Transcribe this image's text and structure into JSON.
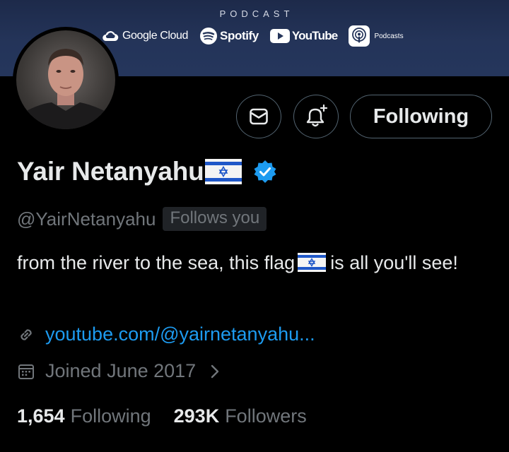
{
  "banner": {
    "title": "PODCAST",
    "sponsors": [
      {
        "name": "google-cloud",
        "label": "Google Cloud"
      },
      {
        "name": "spotify",
        "label": "Spotify"
      },
      {
        "name": "youtube",
        "label": "YouTube"
      },
      {
        "name": "apple-podcasts",
        "label": "Podcasts"
      }
    ]
  },
  "profile": {
    "name": "Yair Netanyahu",
    "handle": "@YairNetanyahu",
    "follows_badge": "Follows you",
    "bio_part1": "from the river to the sea, this flag",
    "bio_part2": "is all you'll see!",
    "link": "youtube.com/@yairnetanyahu...",
    "joined": "Joined June 2017"
  },
  "actions": {
    "following_label": "Following",
    "message_icon": "envelope-icon",
    "notify_icon": "bell-plus-icon"
  },
  "stats": {
    "following_count": "1,654",
    "following_label": "Following",
    "followers_count": "293K",
    "followers_label": "Followers"
  },
  "colors": {
    "background": "#000000",
    "text": "#e7e9ea",
    "muted": "#71767b",
    "accent": "#1d9bf0",
    "border": "#536471",
    "banner": "#243459"
  }
}
